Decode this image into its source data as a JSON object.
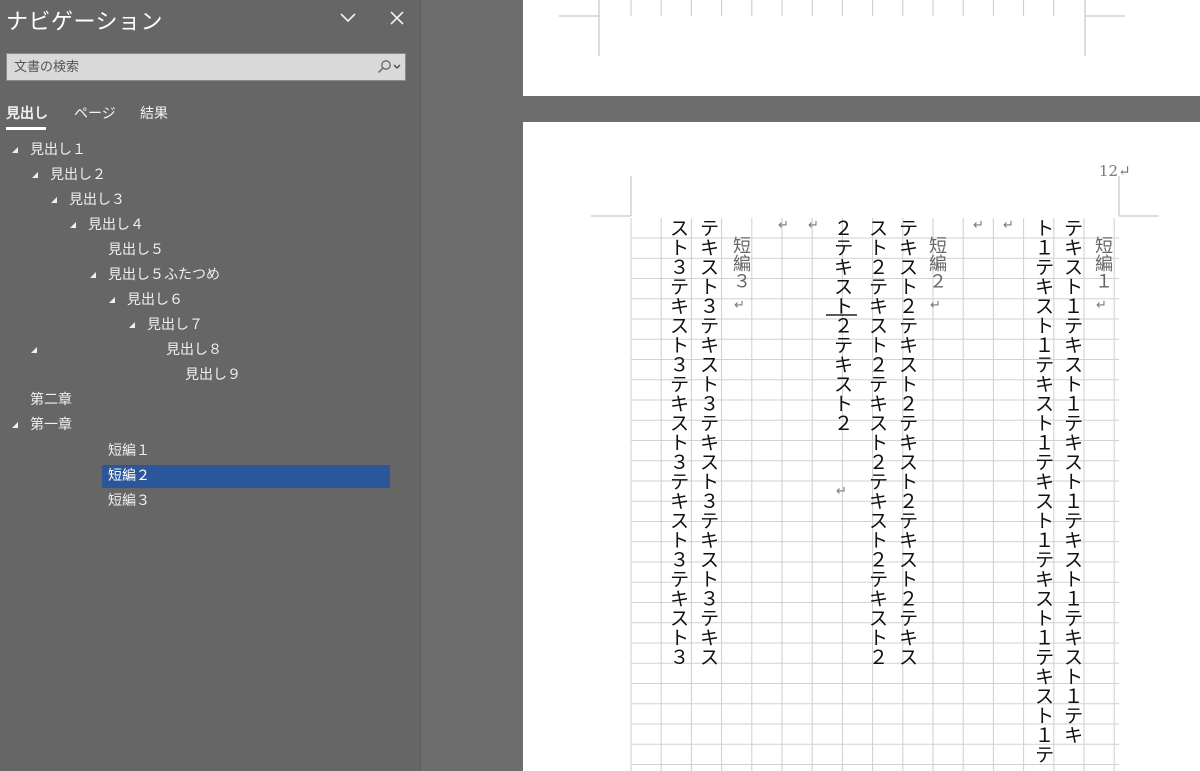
{
  "nav": {
    "title": "ナビゲーション",
    "options_icon": "chevron-down-icon",
    "close_icon": "close-icon",
    "search": {
      "placeholder": "文書の検索",
      "icon": "search-icon"
    },
    "tabs": [
      {
        "label": "見出し",
        "active": true
      },
      {
        "label": "ページ",
        "active": false
      },
      {
        "label": "結果",
        "active": false
      }
    ],
    "tree": [
      {
        "label": "見出し１",
        "level": 1,
        "expanded": true
      },
      {
        "label": "見出し２",
        "level": 2,
        "expanded": true
      },
      {
        "label": "見出し３",
        "level": 3,
        "expanded": true
      },
      {
        "label": "見出し４",
        "level": 4,
        "expanded": true
      },
      {
        "label": "見出し５",
        "level": 5,
        "expanded": null
      },
      {
        "label": "見出し５ふたつめ",
        "level": 5,
        "expanded": true
      },
      {
        "label": "見出し６",
        "level": 6,
        "expanded": true
      },
      {
        "label": "見出し７",
        "level": 7,
        "expanded": true
      },
      {
        "label": "見出し８",
        "level": 8,
        "expanded": true
      },
      {
        "label": "見出し９",
        "level": 9,
        "expanded": null
      },
      {
        "label": "第二章",
        "level": 1,
        "expanded": null
      },
      {
        "label": "第一章",
        "level": 1,
        "expanded": true
      },
      {
        "label": "短編１",
        "level": 5,
        "expanded": null
      },
      {
        "label": "短編２",
        "level": 5,
        "expanded": null,
        "selected": true
      },
      {
        "label": "短編３",
        "level": 5,
        "expanded": null
      }
    ],
    "selected_color": "#2b579a"
  },
  "document": {
    "page_number": "12↵",
    "return_mark": "↵",
    "columns": [
      {
        "kind": "text",
        "text": "テキスト１テキスト１テキスト１テキスト１テキスト１テキ"
      },
      {
        "kind": "text",
        "text": "ト１テキスト１テキスト１テキスト１テキスト１テキスト１テ"
      },
      {
        "kind": "text",
        "text": "テキスト２テキスト２テキスト２テキスト２テキス"
      },
      {
        "kind": "text",
        "text": "スト２テキスト２テキスト２テキスト２テキスト２"
      },
      {
        "kind": "text",
        "text": "２テキスト２テキスト２"
      },
      {
        "kind": "text",
        "text": "テキスト３テキスト３テキスト３テキスト３テキス"
      },
      {
        "kind": "text",
        "text": "スト３テキスト３テキスト３テキスト３テキスト３"
      }
    ],
    "titles": [
      "短編１",
      "短編２",
      "短編３"
    ]
  }
}
